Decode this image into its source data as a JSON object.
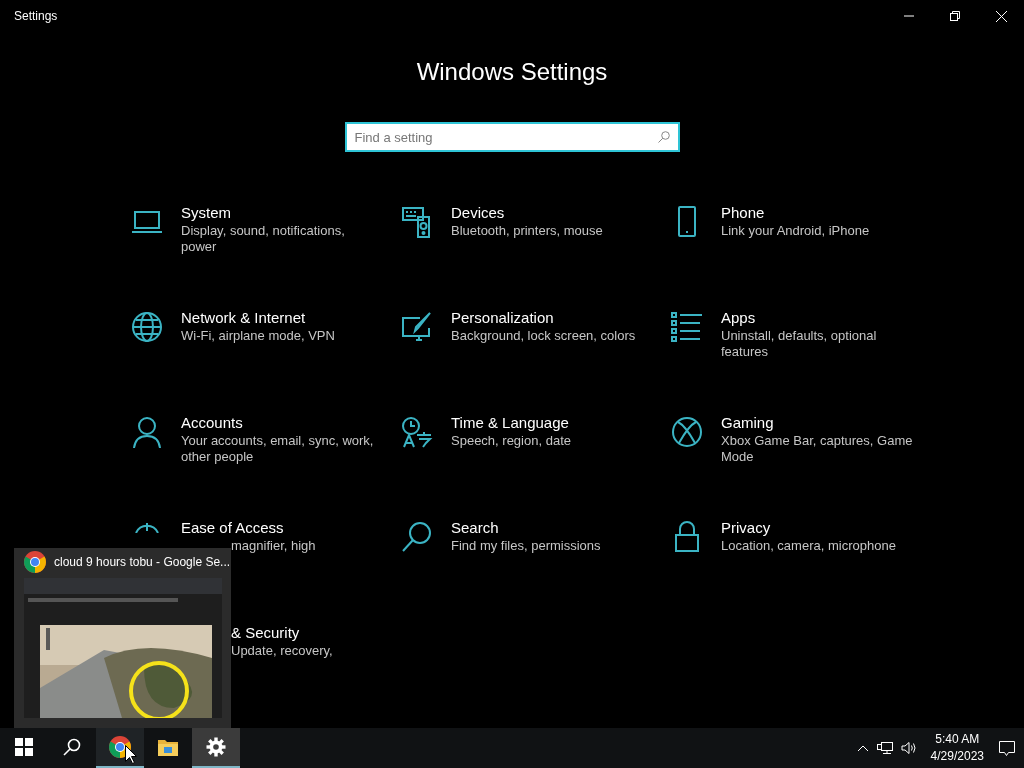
{
  "window": {
    "title": "Settings"
  },
  "header": {
    "title": "Windows Settings"
  },
  "search": {
    "placeholder": "Find a setting"
  },
  "tiles": [
    {
      "kind": "full",
      "title": "System",
      "description": "Display, sound, notifications, power"
    },
    {
      "kind": "full",
      "title": "Devices",
      "description": "Bluetooth, printers, mouse"
    },
    {
      "kind": "full",
      "title": "Phone",
      "description": "Link your Android, iPhone"
    },
    {
      "kind": "full",
      "title": "Network & Internet",
      "description": "Wi-Fi, airplane mode, VPN"
    },
    {
      "kind": "full",
      "title": "Personalization",
      "description": "Background, lock screen, colors"
    },
    {
      "kind": "full",
      "title": "Apps",
      "description": "Uninstall, defaults, optional features"
    },
    {
      "kind": "full",
      "title": "Accounts",
      "description": "Your accounts, email, sync, work, other people"
    },
    {
      "kind": "full",
      "title": "Time & Language",
      "description": "Speech, region, date"
    },
    {
      "kind": "full",
      "title": "Gaming",
      "description": "Xbox Game Bar, captures, Game Mode"
    },
    {
      "kind": "covered_description",
      "title": "Ease of Access",
      "description": "magnifier, high"
    },
    {
      "kind": "full",
      "title": "Search",
      "description": "Find my files, permissions"
    },
    {
      "kind": "full",
      "title": "Privacy",
      "description": "Location, camera, microphone"
    },
    {
      "kind": "covered",
      "title": "& Security",
      "description": "Update, recovery,"
    }
  ],
  "preview": {
    "title": "cloud 9 hours tobu - Google Se...",
    "kind": "picture"
  },
  "taskbar": {
    "items": [
      {
        "running": false,
        "hovered": false,
        "selected": false
      },
      {
        "running": false,
        "hovered": false,
        "selected": false
      },
      {
        "running": true,
        "hovered": true,
        "selected": false
      },
      {
        "running": false,
        "hovered": false,
        "selected": false
      },
      {
        "running": true,
        "hovered": false,
        "selected": true
      }
    ],
    "time": "5:40 AM",
    "date": "4/29/2023"
  }
}
